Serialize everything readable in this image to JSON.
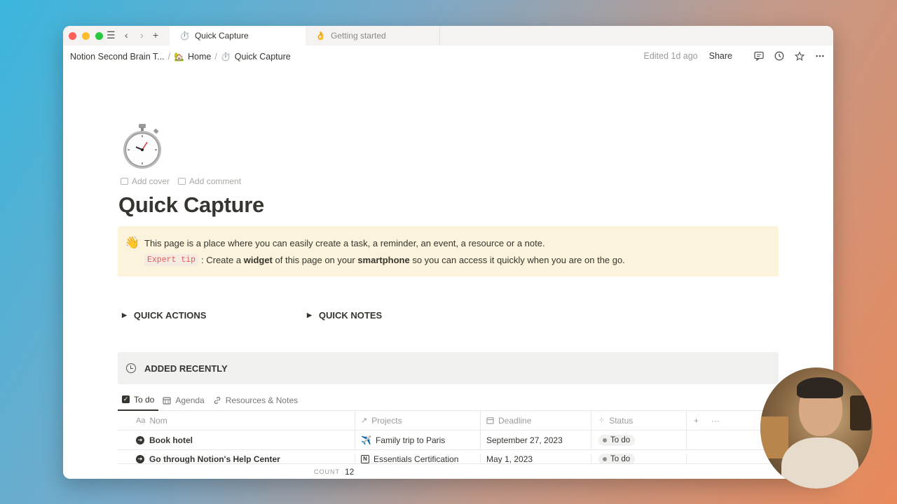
{
  "tabs": [
    {
      "label": "Quick Capture",
      "icon": "⏱️"
    },
    {
      "label": "Getting started",
      "icon": "👌"
    }
  ],
  "breadcrumb": {
    "items": [
      "Notion Second Brain T...",
      "Home",
      "Quick Capture"
    ],
    "home_icon": "🏡",
    "page_icon": "⏱️"
  },
  "topbar": {
    "edited": "Edited 1d ago",
    "share": "Share"
  },
  "page": {
    "icon": "stopwatch-icon",
    "add_cover": "Add cover",
    "add_comment": "Add comment",
    "title": "Quick Capture"
  },
  "callout": {
    "emoji": "👋",
    "line1": "This page is a place where you can easily create a task, a reminder, an event, a resource or a note.",
    "code": "Expert tip",
    "line2_a": ": Create a ",
    "line2_b": "widget",
    "line2_c": " of this page on your ",
    "line2_d": "smartphone",
    "line2_e": " so you can access it quickly when you are on the go."
  },
  "toggles": {
    "quick_actions": "QUICK ACTIONS",
    "quick_notes": "QUICK NOTES"
  },
  "section": {
    "title": "ADDED RECENTLY"
  },
  "views": [
    {
      "label": "To do"
    },
    {
      "label": "Agenda"
    },
    {
      "label": "Resources & Notes"
    }
  ],
  "table": {
    "headers": {
      "name": "Nom",
      "name_prefix": "Aa",
      "projects": "Projects",
      "deadline": "Deadline",
      "status": "Status"
    },
    "rows": [
      {
        "name": "Book hotel",
        "project": "Family trip to Paris",
        "project_icon": "✈️",
        "deadline": "September 27, 2023",
        "status": "To do"
      },
      {
        "name": "Go through Notion's Help Center",
        "project": "Essentials Certification",
        "project_icon": "N",
        "deadline": "May 1, 2023",
        "status": "To do"
      }
    ]
  },
  "count": {
    "label": "COUNT",
    "value": "12"
  },
  "colors": {
    "callout_bg": "#fbf3db",
    "code_text": "#eb5757",
    "text": "#37352f",
    "traffic_red": "#fe5f57",
    "traffic_yellow": "#febc2e",
    "traffic_green": "#28c840"
  }
}
